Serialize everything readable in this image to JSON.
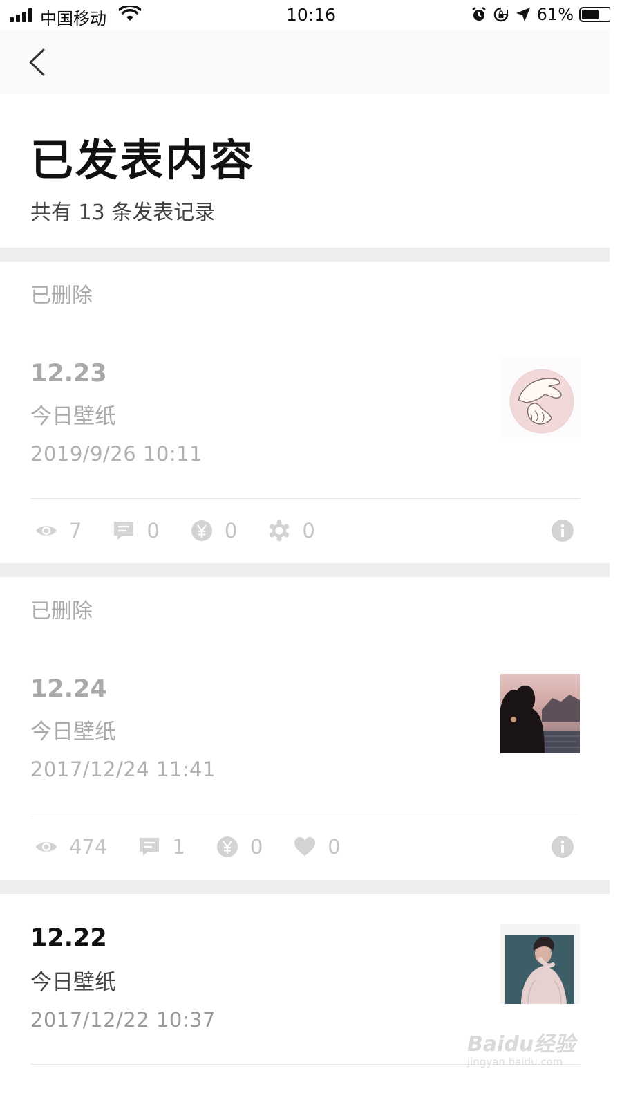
{
  "status_bar": {
    "carrier": "中国移动",
    "time": "10:16",
    "battery": "61%",
    "battery_level": 0.61,
    "icons": [
      "signal-icon",
      "wifi-icon",
      "alarm-icon",
      "rotation-lock-icon",
      "location-arrow-icon",
      "battery-icon"
    ]
  },
  "nav": {
    "back_icon": "chevron-left-icon"
  },
  "header": {
    "title": "已发表内容",
    "subtitle": "共有 13 条发表记录"
  },
  "posts": [
    {
      "status": "已删除",
      "title": "12.23",
      "desc": "今日壁纸",
      "date": "2019/9/26  10:11",
      "thumbnail": "hands-pink-illustration",
      "stats": [
        {
          "icon": "eye-icon",
          "value": "7"
        },
        {
          "icon": "comment-icon",
          "value": "0"
        },
        {
          "icon": "yuan-icon",
          "value": "0"
        },
        {
          "icon": "gear-icon",
          "value": "0"
        }
      ]
    },
    {
      "status": "已删除",
      "title": "12.24",
      "desc": "今日壁纸",
      "date": "2017/12/24  11:41",
      "thumbnail": "couple-silhouette-sunset",
      "stats": [
        {
          "icon": "eye-icon",
          "value": "474"
        },
        {
          "icon": "comment-icon",
          "value": "1"
        },
        {
          "icon": "yuan-icon",
          "value": "0"
        },
        {
          "icon": "heart-icon",
          "value": "0"
        }
      ]
    },
    {
      "status": "",
      "title": "12.22",
      "desc": "今日壁纸",
      "date": "2017/12/22  10:37",
      "thumbnail": "person-pink-sweater-polaroid"
    }
  ],
  "watermark": {
    "main": "Baidu经验",
    "sub": "jingyan.baidu.com"
  }
}
